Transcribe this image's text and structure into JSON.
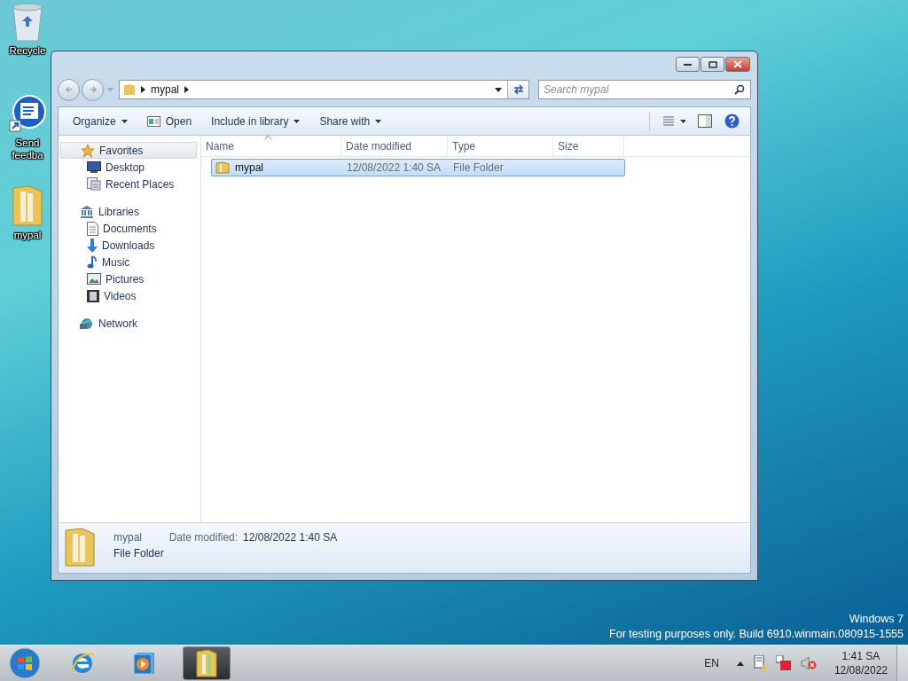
{
  "desktop_icons": [
    {
      "kind": "recycle",
      "lines": [
        "Recycle"
      ]
    },
    {
      "kind": "feedback",
      "lines": [
        "Send",
        "feedba"
      ]
    },
    {
      "kind": "folder",
      "lines": [
        "mypal"
      ]
    }
  ],
  "window": {
    "address": {
      "path": [
        "mypal"
      ]
    },
    "search": {
      "placeholder": "Search mypal"
    },
    "toolbar": [
      {
        "label": "Organize",
        "kind": "menu"
      },
      {
        "label": "Open",
        "kind": "action"
      },
      {
        "label": "Include in library",
        "kind": "menu"
      },
      {
        "label": "Share with",
        "kind": "menu"
      }
    ],
    "nav": [
      {
        "label": "Favorites",
        "kind": "star",
        "selected": true,
        "children": [
          {
            "label": "Desktop",
            "kind": "desktop",
            "selected": false
          },
          {
            "label": "Recent Places",
            "kind": "recent",
            "selected": false
          }
        ]
      },
      {
        "label": "Libraries",
        "kind": "library",
        "selected": false,
        "children": [
          {
            "label": "Documents",
            "kind": "document",
            "selected": false
          },
          {
            "label": "Downloads",
            "kind": "download",
            "selected": false
          },
          {
            "label": "Music",
            "kind": "music",
            "selected": false
          },
          {
            "label": "Pictures",
            "kind": "picture",
            "selected": false
          },
          {
            "label": "Videos",
            "kind": "video",
            "selected": false
          }
        ]
      },
      {
        "label": "Network",
        "kind": "network",
        "selected": false
      }
    ],
    "columns": [
      {
        "label": "Name",
        "sorted": true
      },
      {
        "label": "Date modified",
        "sorted": false
      },
      {
        "label": "Type",
        "sorted": false
      },
      {
        "label": "Size",
        "sorted": false
      }
    ],
    "rows": [
      {
        "name": "mypal",
        "date": "12/08/2022 1:40 SA",
        "type": "File Folder",
        "selected": true
      }
    ],
    "details": {
      "name": "mypal",
      "type": "File Folder",
      "date_label": "Date modified:",
      "date_value": "12/08/2022 1:40 SA"
    }
  },
  "watermark": [
    "Windows 7",
    "For testing purposes only. Build 6910.winmain.080915-1555"
  ],
  "taskbar": {
    "apps": [
      {
        "kind": "ie",
        "active": false
      },
      {
        "kind": "media",
        "active": false
      },
      {
        "kind": "explorer",
        "active": true
      }
    ],
    "language": "EN",
    "time": "1:41 SA",
    "date": "12/08/2022"
  }
}
